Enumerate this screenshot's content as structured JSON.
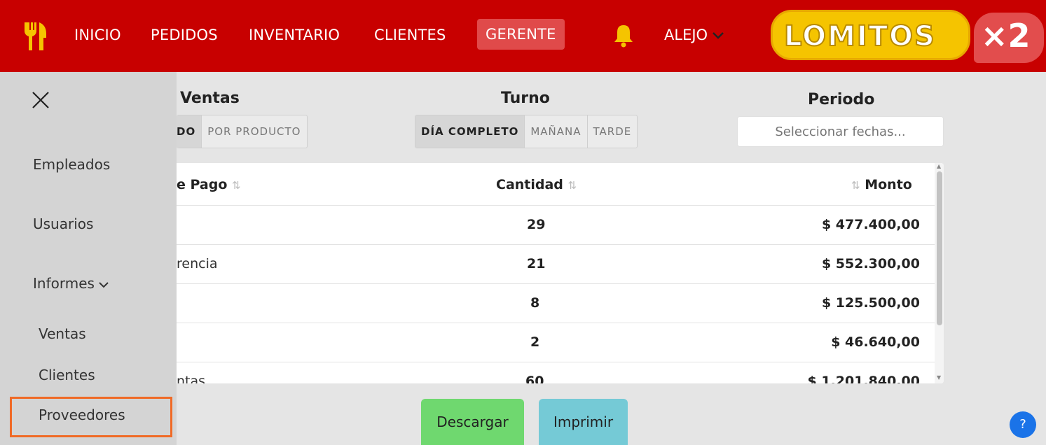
{
  "nav": {
    "links": [
      "INICIO",
      "PEDIDOS",
      "INVENTARIO",
      "CLIENTES",
      "GERENTE"
    ],
    "active": "GERENTE",
    "user": "ALEJO",
    "brand_text": "LOMITOS",
    "brand_x2": "×2"
  },
  "sidebar": {
    "items": [
      "Empleados",
      "Usuarios",
      "Informes"
    ],
    "sub_items": [
      "Ventas",
      "Clientes",
      "Proveedores"
    ],
    "selected": "Proveedores"
  },
  "filters": {
    "ventas": {
      "title": "Ventas",
      "options": [
        "DO",
        "POR PRODUCTO"
      ]
    },
    "turno": {
      "title": "Turno",
      "options": [
        "DÍA COMPLETO",
        "MAÑANA",
        "TARDE"
      ],
      "selected": "DÍA COMPLETO"
    },
    "periodo": {
      "title": "Periodo",
      "placeholder": "Seleccionar fechas..."
    }
  },
  "table": {
    "headers": [
      "e Pago",
      "Cantidad",
      "Monto"
    ],
    "rows": [
      {
        "method": "",
        "qty": "29",
        "amount": "$ 477.400,00"
      },
      {
        "method": "rencia",
        "qty": "21",
        "amount": "$ 552.300,00"
      },
      {
        "method": "",
        "qty": "8",
        "amount": "$ 125.500,00"
      },
      {
        "method": "",
        "qty": "2",
        "amount": "$ 46.640,00"
      },
      {
        "method": "ntas",
        "qty": "60",
        "amount": "$ 1.201.840,00"
      }
    ]
  },
  "actions": {
    "download": "Descargar",
    "print": "Imprimir"
  },
  "help_icon": "?",
  "colors": {
    "nav": "#c80000",
    "highlight_border": "#f06a26",
    "download": "#6fd86f",
    "print": "#75cad6",
    "help": "#1a73e8"
  }
}
